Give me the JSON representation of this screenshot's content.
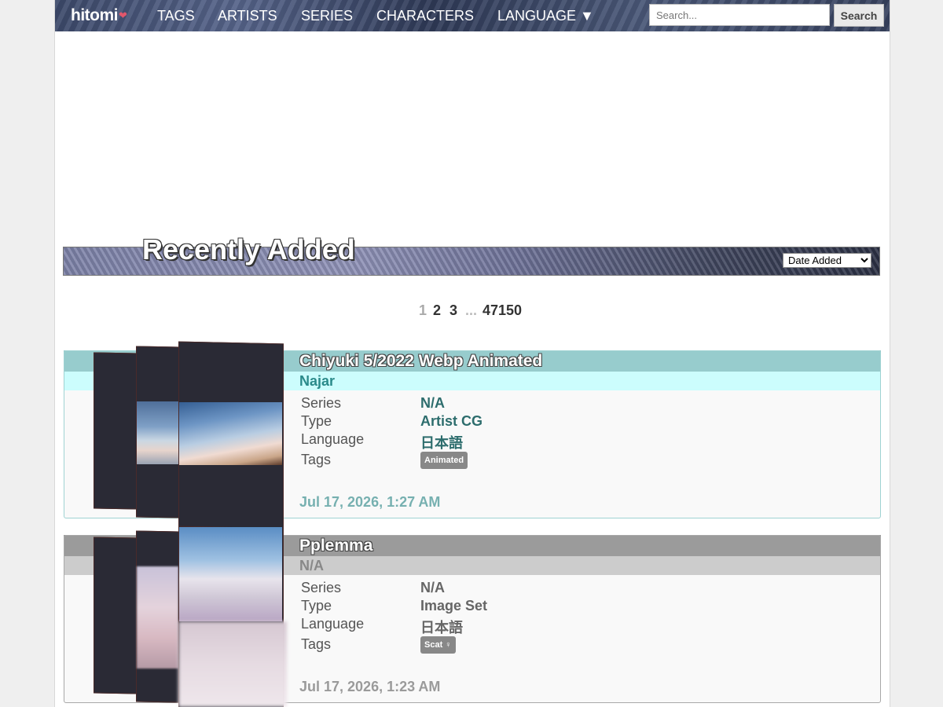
{
  "nav": {
    "logo_text": "hitomi",
    "logo_mark": "❤",
    "links": [
      "TAGS",
      "ARTISTS",
      "SERIES",
      "CHARACTERS",
      "LANGUAGE ▼"
    ]
  },
  "search": {
    "placeholder": "Search...",
    "button_label": "Search"
  },
  "list": {
    "title": "Recently Added",
    "sort_selected": "Date Added"
  },
  "pagination": {
    "current": "1",
    "pages": [
      "2",
      "3"
    ],
    "dots": "...",
    "last": "47150"
  },
  "galleries": [
    {
      "title": "Chiyuki 5/2022 Webp Animated",
      "artist": "Najar",
      "labels": {
        "series": "Series",
        "type": "Type",
        "language": "Language",
        "tags": "Tags"
      },
      "series": "N/A",
      "type": "Artist CG",
      "language": "日本語",
      "tags": [
        "Animated"
      ],
      "date": "Jul 17, 2026, 1:27 AM",
      "colors": {
        "title_bar": "#97cccd",
        "artist_bar": "#ccfdfd"
      }
    },
    {
      "title": "Pplemma",
      "artist": "N/A",
      "labels": {
        "series": "Series",
        "type": "Type",
        "language": "Language",
        "tags": "Tags"
      },
      "series": "N/A",
      "type": "Image Set",
      "language": "日本語",
      "tags": [
        "Scat ♀"
      ],
      "date": "Jul 17, 2026, 1:23 AM",
      "colors": {
        "title_bar": "#9b9b9b",
        "artist_bar": "#cccccc"
      }
    }
  ]
}
